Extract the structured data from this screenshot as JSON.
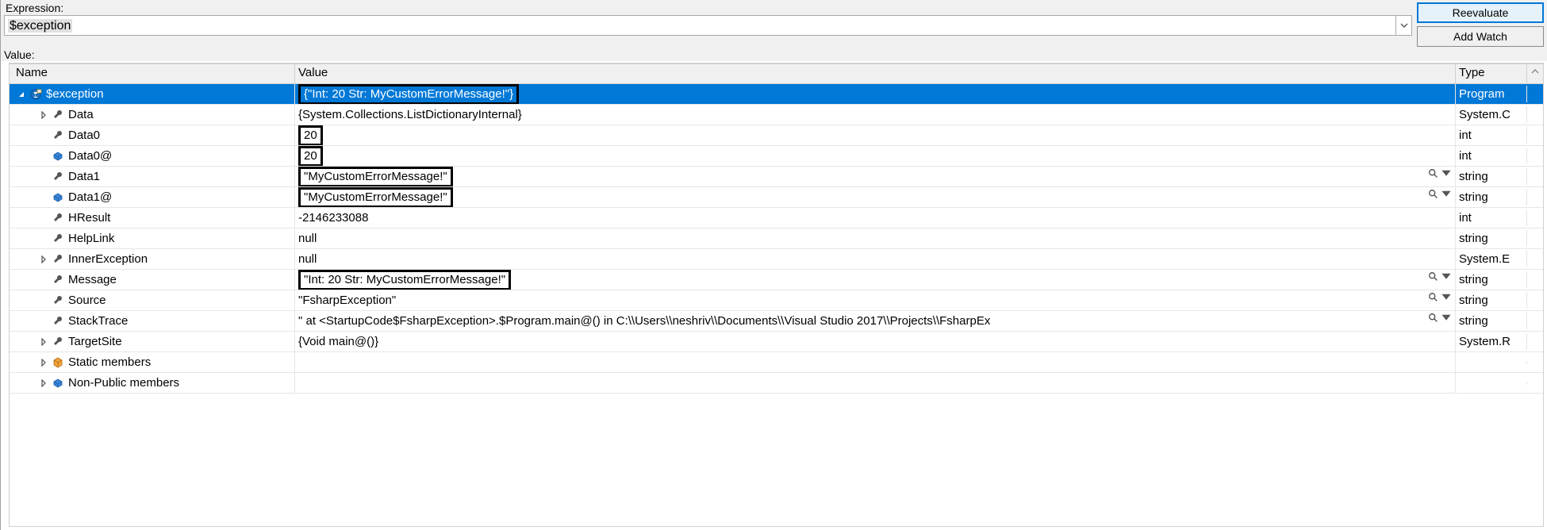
{
  "labels": {
    "expression": "Expression:",
    "value": "Value:"
  },
  "expression_value": "$exception",
  "buttons": {
    "reevaluate": "Reevaluate",
    "add_watch": "Add Watch"
  },
  "columns": {
    "name": "Name",
    "value": "Value",
    "type": "Type"
  },
  "rows": [
    {
      "indent": 0,
      "exp": "open",
      "icon": "exception",
      "name": "$exception",
      "value": "{\"Int: 20 Str: MyCustomErrorMessage!\"}",
      "type": "Program",
      "boxed": true,
      "vis": false,
      "selected": true
    },
    {
      "indent": 1,
      "exp": "closed",
      "icon": "wrench",
      "name": "Data",
      "value": "{System.Collections.ListDictionaryInternal}",
      "type": "System.C",
      "boxed": false,
      "vis": false
    },
    {
      "indent": 1,
      "exp": "none",
      "icon": "wrench",
      "name": "Data0",
      "value": "20",
      "type": "int",
      "boxed": true,
      "vis": false
    },
    {
      "indent": 1,
      "exp": "none",
      "icon": "field",
      "name": "Data0@",
      "value": "20",
      "type": "int",
      "boxed": true,
      "vis": false
    },
    {
      "indent": 1,
      "exp": "none",
      "icon": "wrench",
      "name": "Data1",
      "value": "\"MyCustomErrorMessage!\"",
      "type": "string",
      "boxed": true,
      "vis": true
    },
    {
      "indent": 1,
      "exp": "none",
      "icon": "field",
      "name": "Data1@",
      "value": "\"MyCustomErrorMessage!\"",
      "type": "string",
      "boxed": true,
      "vis": true
    },
    {
      "indent": 1,
      "exp": "none",
      "icon": "wrench",
      "name": "HResult",
      "value": "-2146233088",
      "type": "int",
      "boxed": false,
      "vis": false
    },
    {
      "indent": 1,
      "exp": "none",
      "icon": "wrench",
      "name": "HelpLink",
      "value": "null",
      "type": "string",
      "boxed": false,
      "vis": false
    },
    {
      "indent": 1,
      "exp": "closed",
      "icon": "wrench",
      "name": "InnerException",
      "value": "null",
      "type": "System.E",
      "boxed": false,
      "vis": false
    },
    {
      "indent": 1,
      "exp": "none",
      "icon": "wrench",
      "name": "Message",
      "value": "\"Int: 20 Str: MyCustomErrorMessage!\"",
      "type": "string",
      "boxed": true,
      "vis": true
    },
    {
      "indent": 1,
      "exp": "none",
      "icon": "wrench",
      "name": "Source",
      "value": "\"FsharpException\"",
      "type": "string",
      "boxed": false,
      "vis": true
    },
    {
      "indent": 1,
      "exp": "none",
      "icon": "wrench",
      "name": "StackTrace",
      "value": "\"   at <StartupCode$FsharpException>.$Program.main@() in C:\\\\Users\\\\neshriv\\\\Documents\\\\Visual Studio 2017\\\\Projects\\\\FsharpEx",
      "type": "string",
      "boxed": false,
      "vis": true
    },
    {
      "indent": 1,
      "exp": "closed",
      "icon": "wrench",
      "name": "TargetSite",
      "value": "{Void main@()}",
      "type": "System.R",
      "boxed": false,
      "vis": false
    },
    {
      "indent": 1,
      "exp": "closed",
      "icon": "static",
      "name": "Static members",
      "value": "",
      "type": "",
      "boxed": false,
      "vis": false
    },
    {
      "indent": 1,
      "exp": "closed",
      "icon": "nonpublic",
      "name": "Non-Public members",
      "value": "",
      "type": "",
      "boxed": false,
      "vis": false
    }
  ]
}
